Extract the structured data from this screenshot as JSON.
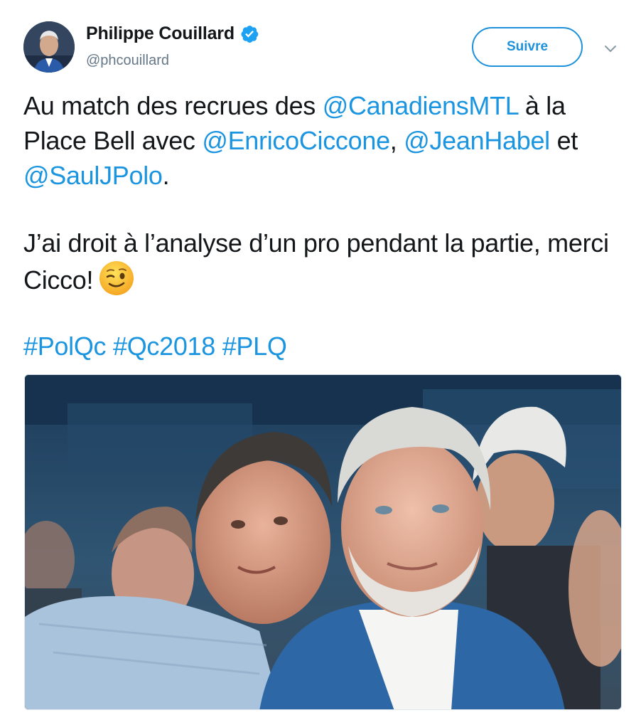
{
  "author": {
    "name": "Philippe Couillard",
    "handle": "@phcouillard",
    "verified": true,
    "avatar_icon": "profile-avatar"
  },
  "follow_button": {
    "label": "Suivre"
  },
  "menu_icon": "chevron-down-icon",
  "tweet": {
    "p1": {
      "t1": "Au match des recrues des ",
      "m1": "@CanadiensMTL",
      "t2": " à la Place Bell avec ",
      "m2": "@EnricoCiccone",
      "t3": ", ",
      "m3": "@JeanHabel",
      "t4": " et ",
      "m4": "@SaulJPolo",
      "t5": "."
    },
    "p2": {
      "text": "J’ai droit à l’analyse d’un pro pendant la partie, merci Cicco!",
      "emoji": "winking-face-emoji"
    },
    "hashtags": [
      "#PolQc",
      "#Qc2018",
      "#PLQ"
    ]
  },
  "media": {
    "type": "photo"
  },
  "colors": {
    "link": "#1b95e0",
    "text": "#14171a",
    "secondary": "#657786",
    "verified": "#1da1f2"
  }
}
